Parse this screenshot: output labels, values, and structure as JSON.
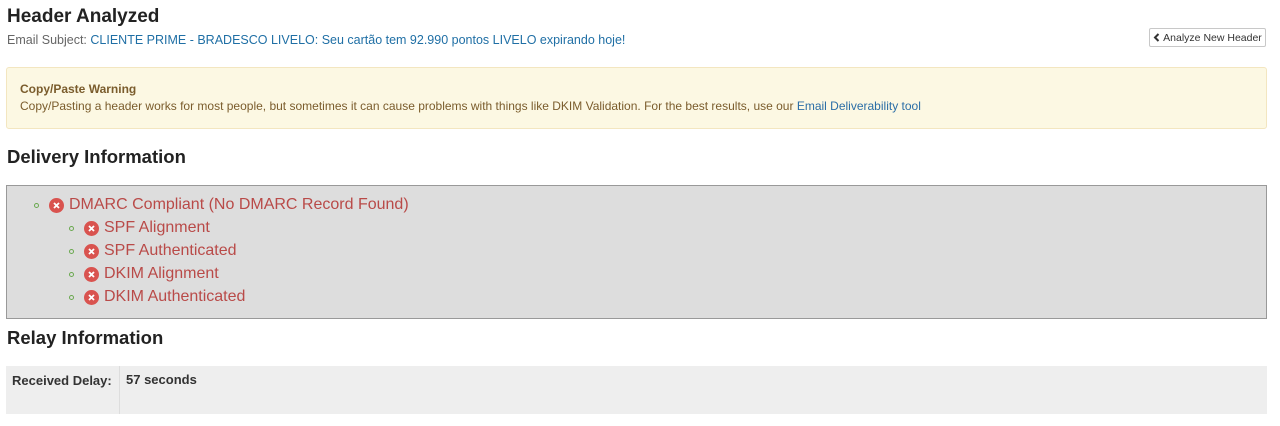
{
  "header": {
    "title": "Header Analyzed",
    "subject_label": "Email Subject:",
    "subject_value": "CLIENTE PRIME - BRADESCO LIVELO: Seu cartão tem 92.990 pontos LIVELO expirando hoje!",
    "analyze_button_label": "Analyze New Header",
    "analyze_button_icon": "chevron-left-icon"
  },
  "warning": {
    "title": "Copy/Paste Warning",
    "text": "Copy/Pasting a header works for most people, but sometimes it can cause problems with things like DKIM Validation. For the best results, use our",
    "link_label": "Email Deliverability tool"
  },
  "delivery": {
    "heading": "Delivery Information",
    "status_icon": "x-circle-icon",
    "status_color": "#b94a48",
    "items": [
      {
        "label": "DMARC Compliant (No DMARC Record Found)",
        "level": 0,
        "passed": false
      },
      {
        "label": "SPF Alignment",
        "level": 1,
        "passed": false
      },
      {
        "label": "SPF Authenticated",
        "level": 1,
        "passed": false
      },
      {
        "label": "DKIM Alignment",
        "level": 1,
        "passed": false
      },
      {
        "label": "DKIM Authenticated",
        "level": 1,
        "passed": false
      }
    ]
  },
  "relay": {
    "heading": "Relay Information",
    "received_delay_label": "Received Delay:",
    "received_delay_value": "57 seconds"
  },
  "colors": {
    "link": "#1f6fa5",
    "warning_bg": "#fcf8e3",
    "error": "#d9534f",
    "delivery_box_bg": "#dddddd"
  }
}
